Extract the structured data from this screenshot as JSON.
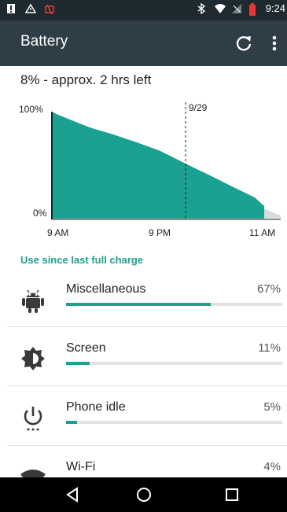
{
  "status_bar": {
    "time": "9:24",
    "left_icons": [
      "notification-icon",
      "warning-icon",
      "battery-alert-icon"
    ],
    "right_icons": [
      "bluetooth-icon",
      "wifi-icon",
      "no-signal-icon",
      "battery-low-icon"
    ]
  },
  "toolbar": {
    "title": "Battery",
    "refresh_icon": "refresh-icon",
    "more_icon": "more-vert-icon"
  },
  "summary": "8% - approx. 2 hrs left",
  "chart": {
    "y_top_label": "100%",
    "y_bottom_label": "0%",
    "marker_label": "9/29",
    "x_labels": [
      "9 AM",
      "9 PM",
      "11 AM"
    ],
    "fill_color": "#1aa191",
    "projection_color": "#dcdcdc"
  },
  "chart_data": {
    "type": "area",
    "x": [
      "9 AM",
      "9 PM",
      "11 AM"
    ],
    "series": [
      {
        "values": [
          100,
          45,
          8
        ]
      }
    ],
    "ylim": [
      0,
      100
    ]
  },
  "section_header": "Use since last full charge",
  "usage_items": [
    {
      "name": "Miscellaneous",
      "percent": "67%",
      "value": 0.67,
      "icon": "android-icon"
    },
    {
      "name": "Screen",
      "percent": "11%",
      "value": 0.11,
      "icon": "brightness-icon"
    },
    {
      "name": "Phone idle",
      "percent": "5%",
      "value": 0.05,
      "icon": "power-idle-icon"
    },
    {
      "name": "Wi-Fi",
      "percent": "4%",
      "value": 0.04,
      "icon": "wifi-icon"
    }
  ],
  "nav_bar": {
    "back_icon": "back-icon",
    "home_icon": "home-icon",
    "recents_icon": "recents-icon"
  },
  "colors": {
    "accent": "#1aa191",
    "toolbar": "#2f3d46",
    "status_bar": "#1f2a30"
  }
}
